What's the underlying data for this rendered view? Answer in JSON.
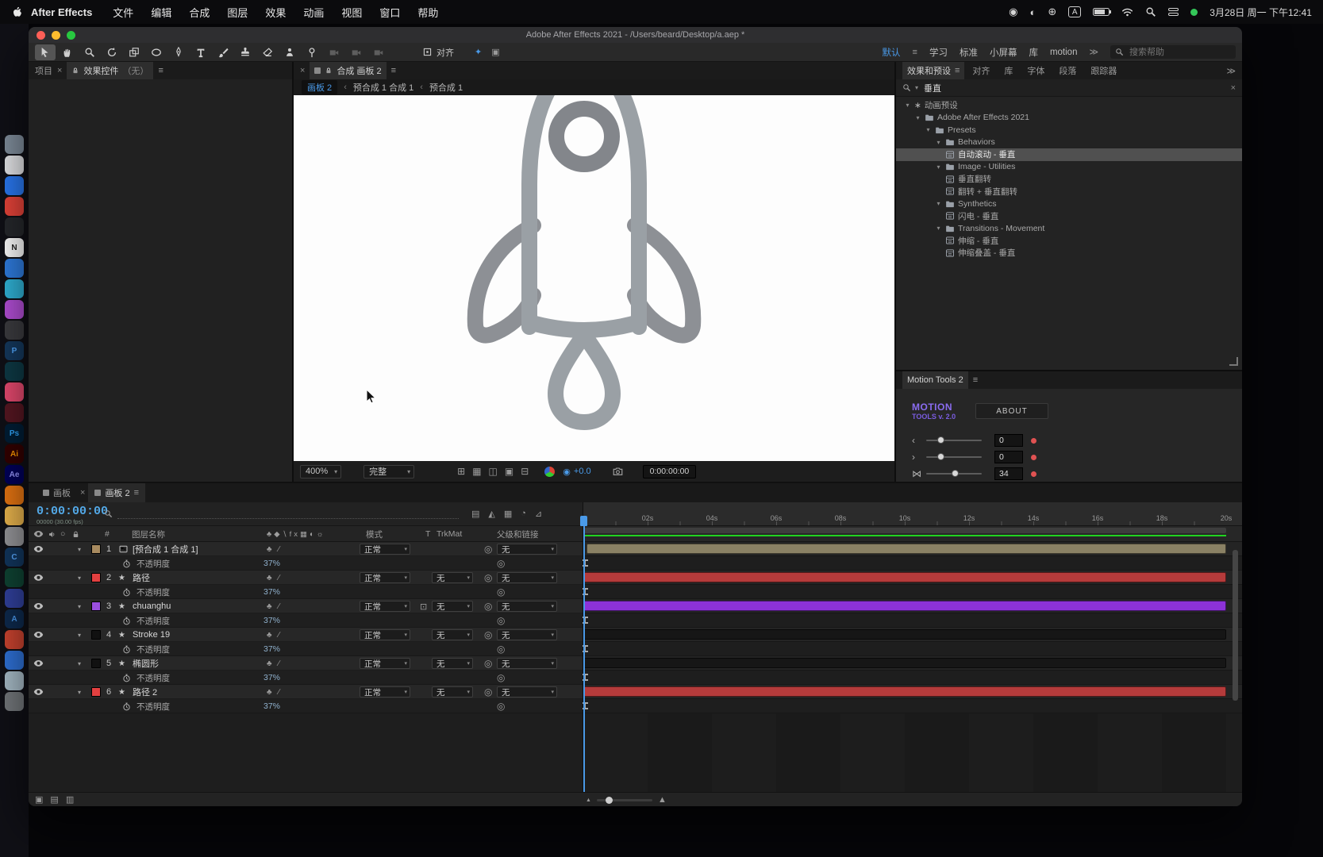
{
  "colors": {
    "accent": "#4a9ae8",
    "time_display": "#53a9e8",
    "cache_line": "#21d421",
    "bar_precomp": "#8a8164",
    "bar_red": "#b53b3b",
    "bar_purple": "#8c32d8",
    "bar_dark": "#161616"
  },
  "menubar": {
    "app_name": "After Effects",
    "menus": [
      "文件",
      "编辑",
      "合成",
      "图层",
      "效果",
      "动画",
      "视图",
      "窗口",
      "帮助"
    ],
    "clock": "3月28日 周一 下午12:41"
  },
  "dock": {
    "icons": [
      {
        "name": "dock-app-01",
        "bg": "#808e9c",
        "label": ""
      },
      {
        "name": "dock-app-02",
        "bg": "#e6e7ea",
        "label": ""
      },
      {
        "name": "dock-app-03",
        "bg": "#2a79f2",
        "label": ""
      },
      {
        "name": "dock-app-04",
        "bg": "#e8443a",
        "label": ""
      },
      {
        "name": "dock-app-05",
        "bg": "#26282c",
        "label": ""
      },
      {
        "name": "dock-app-notion",
        "bg": "#ffffff",
        "label": "N",
        "fg": "#222222"
      },
      {
        "name": "dock-app-07",
        "bg": "#2f7de1",
        "label": ""
      },
      {
        "name": "dock-app-08",
        "bg": "#30b4d8",
        "label": ""
      },
      {
        "name": "dock-app-09",
        "bg": "#b44fd8",
        "label": ""
      },
      {
        "name": "dock-app-10",
        "bg": "#3c3c40",
        "label": ""
      },
      {
        "name": "dock-app-11",
        "bg": "#15395e",
        "label": "P",
        "fg": "#52a8ff"
      },
      {
        "name": "dock-app-12",
        "bg": "#0e3a46",
        "label": ""
      },
      {
        "name": "dock-app-13",
        "bg": "#e84a70",
        "label": ""
      },
      {
        "name": "dock-app-14",
        "bg": "#571722",
        "label": ""
      },
      {
        "name": "dock-app-photoshop",
        "bg": "#001e36",
        "label": "Ps",
        "fg": "#31a8ff"
      },
      {
        "name": "dock-app-illustrator",
        "bg": "#330000",
        "label": "Ai",
        "fg": "#ff9a00"
      },
      {
        "name": "dock-app-aftereffects",
        "bg": "#00005b",
        "label": "Ae",
        "fg": "#9999ff"
      },
      {
        "name": "dock-app-18",
        "bg": "#e87612",
        "label": ""
      },
      {
        "name": "dock-app-19",
        "bg": "#ecb64e",
        "label": ""
      },
      {
        "name": "dock-app-20",
        "bg": "#96969a",
        "label": ""
      },
      {
        "name": "dock-app-21",
        "bg": "#12365e",
        "label": "C",
        "fg": "#5aa9ff"
      },
      {
        "name": "dock-app-22",
        "bg": "#0f4434",
        "label": ""
      },
      {
        "name": "dock-app-23",
        "bg": "#31419e",
        "label": ""
      },
      {
        "name": "dock-app-24",
        "bg": "#0e2a4e",
        "label": "A",
        "fg": "#4a9af0"
      },
      {
        "name": "dock-app-25",
        "bg": "#cc4430",
        "label": ""
      },
      {
        "name": "dock-app-26",
        "bg": "#2f72d8",
        "label": ""
      },
      {
        "name": "dock-app-27",
        "bg": "#a8bcc8",
        "label": ""
      },
      {
        "name": "dock-trash",
        "bg": "#74787c",
        "label": ""
      }
    ]
  },
  "window": {
    "title": "Adobe After Effects 2021 - /Users/beard/Desktop/a.aep *"
  },
  "toolbar": {
    "tools": [
      {
        "name": "selection-tool",
        "icon": "arrow",
        "active": true
      },
      {
        "name": "hand-tool",
        "icon": "hand"
      },
      {
        "name": "zoom-tool",
        "icon": "zoom"
      },
      {
        "name": "rotation-tool",
        "icon": "rotate"
      },
      {
        "name": "pan-behind-tool",
        "icon": "panbehind"
      },
      {
        "name": "shape-tool",
        "icon": "ellipse"
      },
      {
        "name": "pen-tool",
        "icon": "pen"
      },
      {
        "name": "type-tool",
        "icon": "type"
      },
      {
        "name": "brush-tool",
        "icon": "brush"
      },
      {
        "name": "clone-stamp-tool",
        "icon": "stamp"
      },
      {
        "name": "eraser-tool",
        "icon": "eraser"
      },
      {
        "name": "roto-brush-tool",
        "icon": "roto"
      },
      {
        "name": "puppet-pin-tool",
        "icon": "pin"
      },
      {
        "name": "camera-tool-1",
        "icon": "camera3d",
        "disabled": true
      },
      {
        "name": "camera-tool-2",
        "icon": "camera3d",
        "disabled": true
      },
      {
        "name": "camera-tool-3",
        "icon": "camera3d",
        "disabled": true
      }
    ],
    "align_label": "对齐",
    "extra_icons": [
      {
        "name": "motion-sketch-icon",
        "glyph": "✦"
      },
      {
        "name": "mask-expansion-icon",
        "glyph": "▣"
      }
    ],
    "workspaces": [
      "默认",
      "学习",
      "标准",
      "小屏幕",
      "库",
      "motion"
    ],
    "active_workspace": "默认",
    "overflow_label": "≫",
    "search_placeholder": "搜索帮助"
  },
  "left_panel": {
    "tab_project": "项目",
    "tab_effect_controls": "效果控件",
    "tab_effect_controls_suffix": "（无）"
  },
  "comp_panel": {
    "tab_label": "合成 画板 2",
    "breadcrumb": {
      "current": "画板 2",
      "crumb1": "预合成 1 合成 1",
      "crumb2": "预合成 1"
    },
    "zoom_value": "400%",
    "resolution_value": "完整",
    "view_icons": [
      {
        "name": "view-layout-icon",
        "glyph": "⊞"
      },
      {
        "name": "transparency-grid-icon",
        "glyph": "▦"
      },
      {
        "name": "mask-visibility-icon",
        "glyph": "◫"
      },
      {
        "name": "region-of-interest-icon",
        "glyph": "▣"
      },
      {
        "name": "guides-options-icon",
        "glyph": "⊟"
      }
    ],
    "exposure_value": "+0.0",
    "time_value": "0:00:00:00"
  },
  "effects_panel": {
    "tab_label": "效果和预设",
    "sibling_tabs": [
      "对齐",
      "库",
      "字体",
      "段落",
      "跟踪器"
    ],
    "overflow_label": "≫",
    "search_value": "垂直",
    "tree": [
      {
        "indent": 0,
        "type": "root",
        "label": "动画预设",
        "twirl": true
      },
      {
        "indent": 1,
        "type": "folder",
        "label": "Adobe After Effects 2021",
        "twirl": true
      },
      {
        "indent": 2,
        "type": "folder",
        "label": "Presets",
        "twirl": true
      },
      {
        "indent": 3,
        "type": "folder",
        "label": "Behaviors",
        "twirl": true
      },
      {
        "indent": 4,
        "type": "preset",
        "label": "自动滚动 - 垂直",
        "selected": true
      },
      {
        "indent": 3,
        "type": "folder",
        "label": "Image - Utilities",
        "twirl": true
      },
      {
        "indent": 4,
        "type": "preset",
        "label": "垂直翻转"
      },
      {
        "indent": 4,
        "type": "preset",
        "label": "翻转 + 垂直翻转"
      },
      {
        "indent": 3,
        "type": "folder",
        "label": "Synthetics",
        "twirl": true
      },
      {
        "indent": 4,
        "type": "preset",
        "label": "闪电 - 垂直"
      },
      {
        "indent": 3,
        "type": "folder",
        "label": "Transitions - Movement",
        "twirl": true
      },
      {
        "indent": 4,
        "type": "preset",
        "label": "伸缩 - 垂直"
      },
      {
        "indent": 4,
        "type": "preset",
        "label": "伸缩叠盖 - 垂直"
      }
    ]
  },
  "motion_tools": {
    "panel_title": "Motion Tools 2",
    "logo_line1": "MOTION",
    "logo_line2": "TOOLS v. 2.0",
    "about_label": "ABOUT",
    "rows": [
      {
        "name": "offset-left-control",
        "icon": "‹",
        "value": "0",
        "knob": 20
      },
      {
        "name": "offset-right-control",
        "icon": "›",
        "value": "0",
        "knob": 20
      },
      {
        "name": "squash-control",
        "icon": "⋈",
        "value": "34",
        "knob": 45
      }
    ]
  },
  "timeline": {
    "tab1": "画板",
    "tab2": "画板 2",
    "time_display": "0:00:00:00",
    "frame_info": "00000 (30.00 fps)",
    "strip_icons": [
      {
        "name": "quality-icon",
        "glyph": "▤"
      },
      {
        "name": "shy-icon",
        "glyph": "◭"
      },
      {
        "name": "frame-blend-icon",
        "glyph": "▦"
      },
      {
        "name": "motion-blur-icon",
        "glyph": "◔"
      },
      {
        "name": "graph-editor-icon",
        "glyph": "⊿"
      }
    ],
    "headers": {
      "number": "#",
      "name": "图层名称",
      "mode": "模式",
      "trkmat_t": "T",
      "trkmat": "TrkMat",
      "parent": "父级和链接"
    },
    "switch_icons": "♣◆∖fx▦◐☼",
    "row_switches": "♣∕",
    "mode_value": "正常",
    "none_value": "无",
    "opacity_label": "不透明度",
    "opacity_value": "37%",
    "layers": [
      {
        "num": "1",
        "name": "[预合成 1 合成 1]",
        "type": "precomp",
        "swatch": "#a78a5f",
        "bar": "#8a8164",
        "trkmat": false
      },
      {
        "num": "2",
        "name": "路径",
        "type": "shape",
        "swatch": "#e24040",
        "bar": "#b53b3b",
        "trkmat": true
      },
      {
        "num": "3",
        "name": "chuanghu",
        "type": "shape",
        "swatch": "#9a4fe0",
        "bar": "#8c32d8",
        "trkmat": true,
        "trkmat_icon": true
      },
      {
        "num": "4",
        "name": "Stroke 19",
        "type": "shape",
        "swatch": "#111111",
        "bar": "#161616",
        "trkmat": true
      },
      {
        "num": "5",
        "name": "椭圆形",
        "type": "shape",
        "swatch": "#111111",
        "bar": "#161616",
        "trkmat": true
      },
      {
        "num": "6",
        "name": "路径 2",
        "type": "shape",
        "swatch": "#e24040",
        "bar": "#b53b3b",
        "trkmat": true
      }
    ],
    "ruler_labels": [
      "02s",
      "04s",
      "06s",
      "08s",
      "10s",
      "12s",
      "14s",
      "16s",
      "18s",
      "20s"
    ],
    "bottom_icons": [
      {
        "name": "expand-layers-icon",
        "glyph": "▣"
      },
      {
        "name": "frame-view-icon",
        "glyph": "▤"
      },
      {
        "name": "transfer-controls-icon",
        "glyph": "▥"
      }
    ]
  }
}
